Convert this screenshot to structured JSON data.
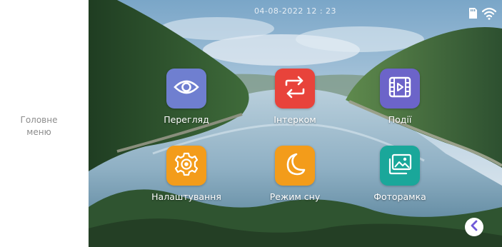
{
  "sidebar": {
    "title": "Головне\nменю"
  },
  "status_bar": {
    "datetime": "04-08-2022   12 : 23",
    "icons": [
      "sd-card-icon",
      "wifi-icon"
    ]
  },
  "menu": {
    "items": [
      {
        "label": "Перегляд",
        "icon": "eye-icon",
        "color": "#6f7fd0"
      },
      {
        "label": "Інтерком",
        "icon": "swap-arrows-icon",
        "color": "#e8433b"
      },
      {
        "label": "Події",
        "icon": "film-play-icon",
        "color": "#6c64c9"
      },
      {
        "label": "Налаштування",
        "icon": "gear-icon",
        "color": "#f39c1a"
      },
      {
        "label": "Режим сну",
        "icon": "moon-icon",
        "color": "#f39c1a"
      },
      {
        "label": "Фоторамка",
        "icon": "photos-icon",
        "color": "#1aa79a"
      }
    ]
  },
  "back_button": {
    "icon": "chevron-left-icon",
    "color": "#6f59d8"
  }
}
